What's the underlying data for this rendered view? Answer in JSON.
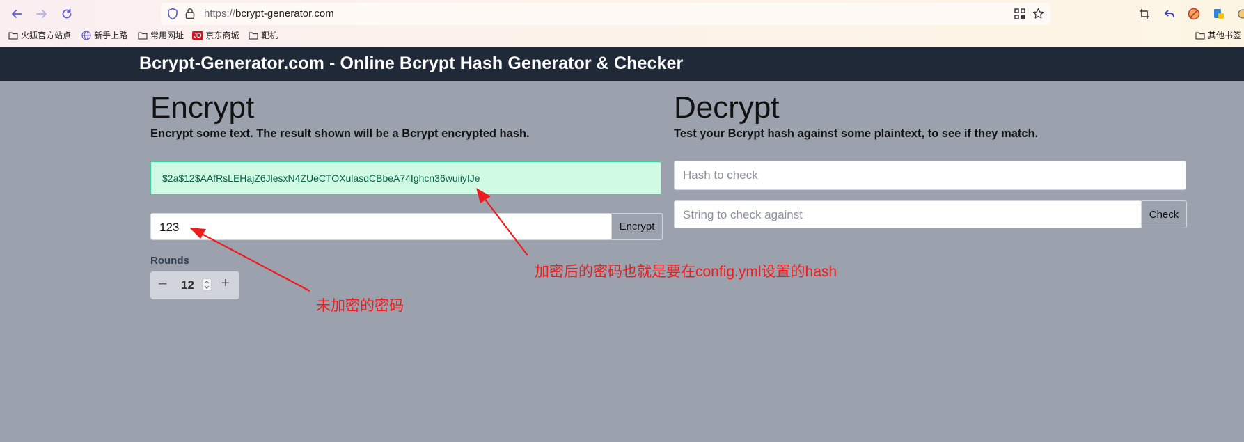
{
  "browser": {
    "url_protocol": "https://",
    "url_host": "bcrypt-generator.com",
    "bookmarks": [
      "火狐官方站点",
      "新手上路",
      "常用网址",
      "京东商城",
      "靶机"
    ],
    "other_bookmarks": "其他书签",
    "jd_badge": "JD"
  },
  "site": {
    "title": "Bcrypt-Generator.com - Online Bcrypt Hash Generator & Checker"
  },
  "encrypt": {
    "heading": "Encrypt",
    "subtitle": "Encrypt some text. The result shown will be a Bcrypt encrypted hash.",
    "result_hash": "$2a$12$AAfRsLEHajZ6JlesxN4ZUeCTOXulasdCBbeA74Ighcn36wuiiyIJe",
    "input_value": "123",
    "button_label": "Encrypt",
    "rounds_label": "Rounds",
    "rounds_value": "12",
    "minus": "–",
    "plus": "+"
  },
  "decrypt": {
    "heading": "Decrypt",
    "subtitle": "Test your Bcrypt hash against some plaintext, to see if they match.",
    "hash_placeholder": "Hash to check",
    "string_placeholder": "String to check against",
    "button_label": "Check"
  },
  "annotations": {
    "hash_note": "加密后的密码也就是要在config.yml设置的hash",
    "plain_note": "未加密的密码"
  },
  "colors": {
    "header_bg": "#1f2937",
    "page_bg": "#9ba1ad",
    "success_bg": "#d1fae5",
    "success_border": "#34d399",
    "annotation_red": "#ee1c1c"
  }
}
